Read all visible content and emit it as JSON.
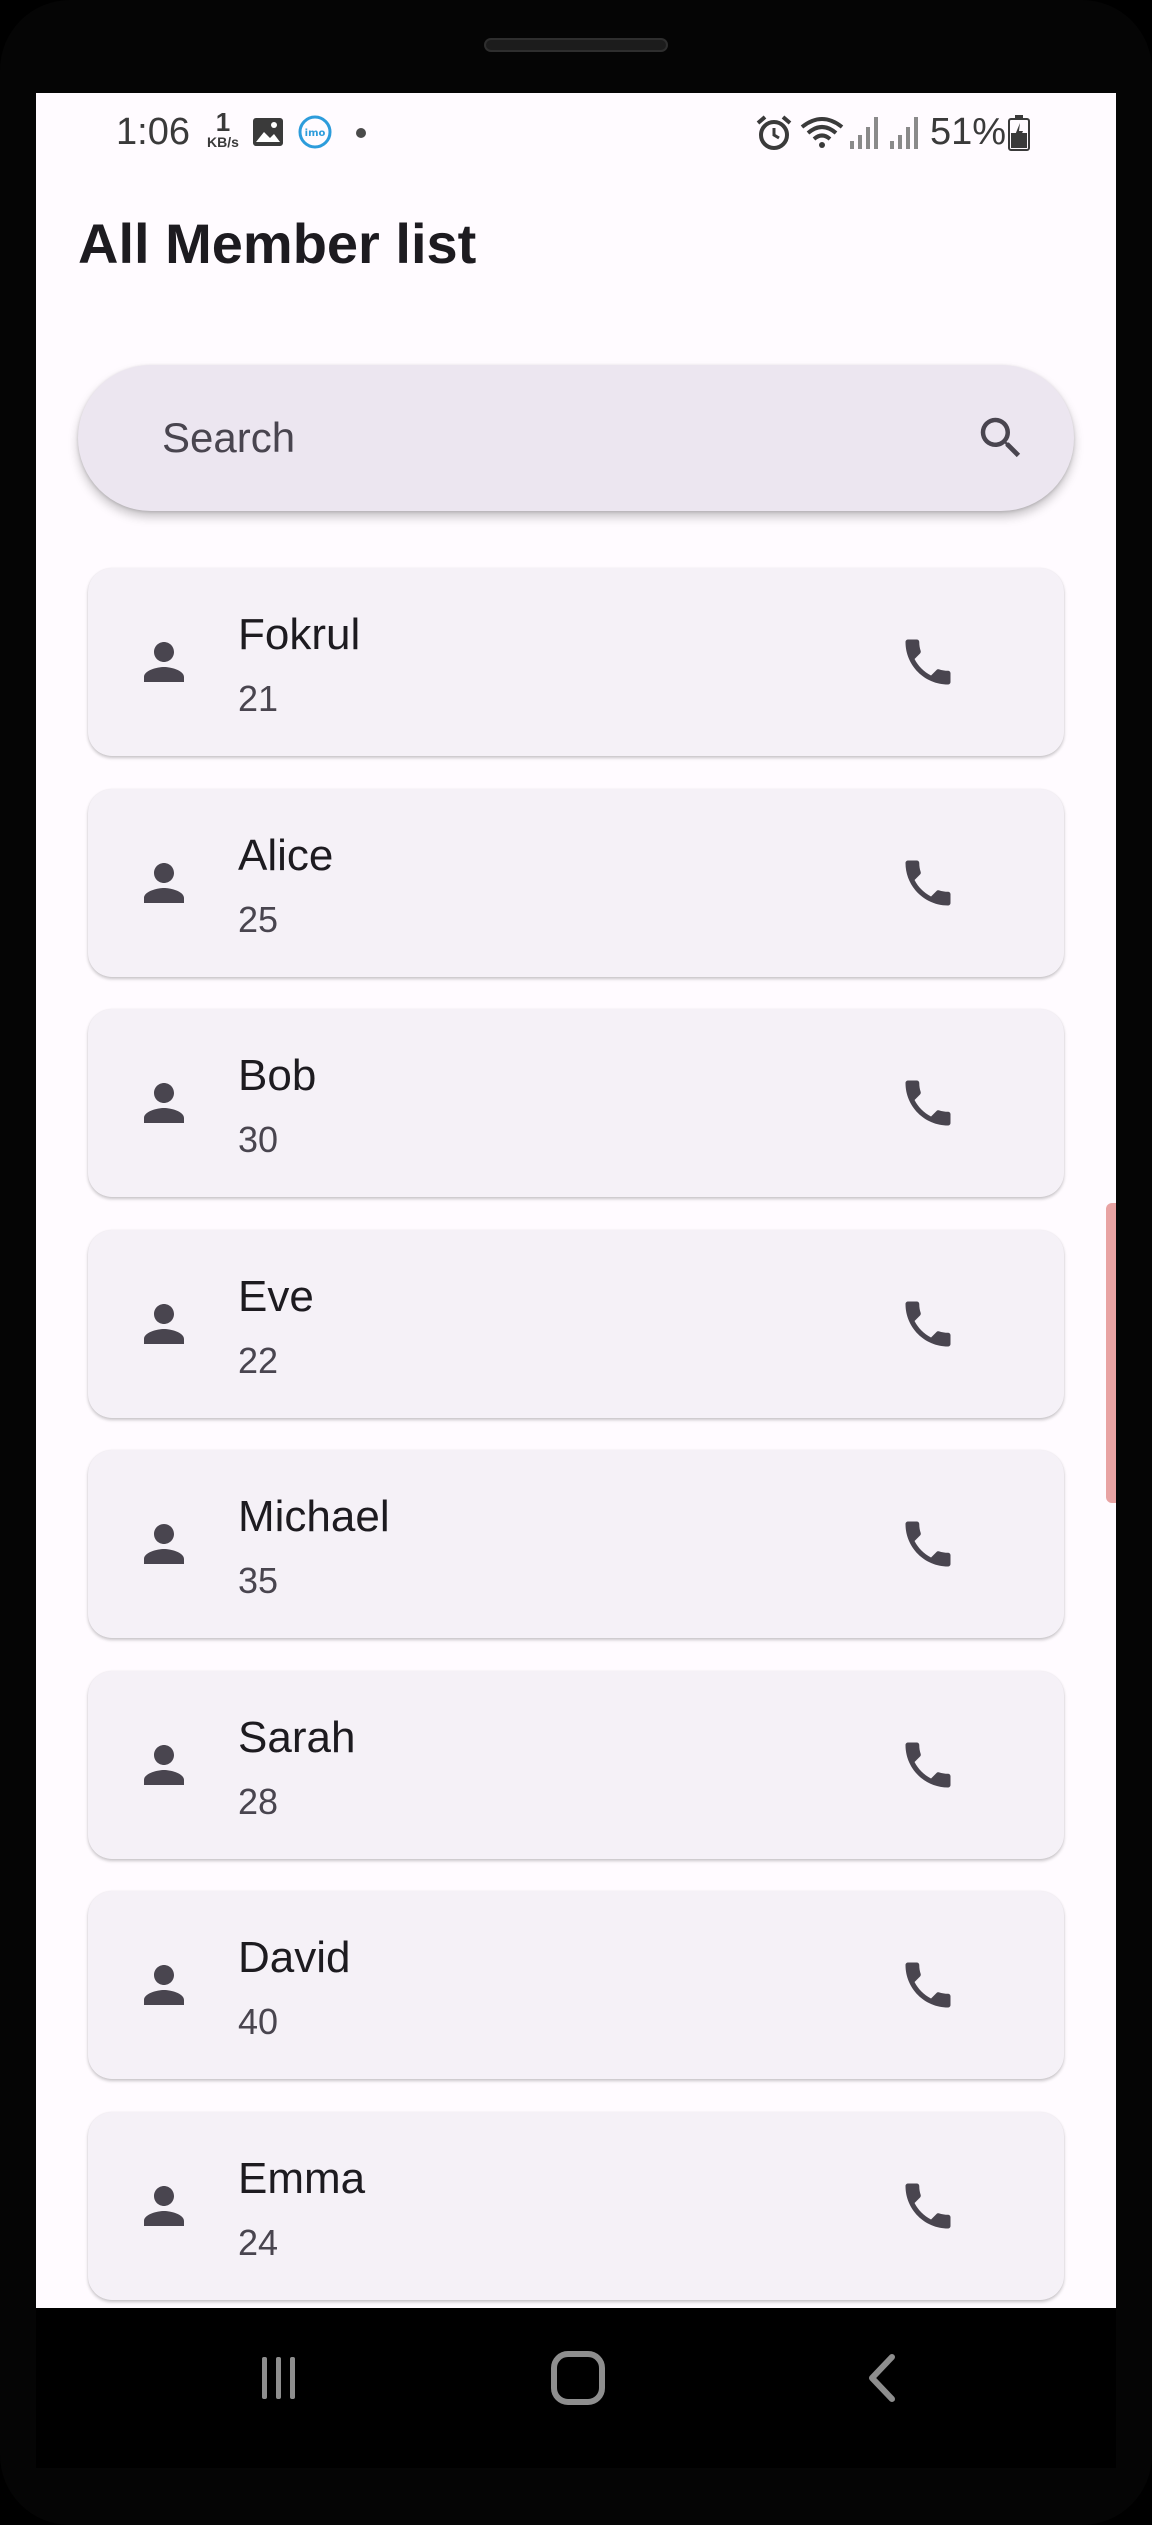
{
  "status_bar": {
    "time": "1:06",
    "net_speed_value": "1",
    "net_speed_unit": "KB/s",
    "battery_percent": "51%",
    "icons": [
      "gallery-icon",
      "imo-icon",
      "alarm-icon",
      "wifi-icon",
      "signal-icon",
      "battery-icon"
    ]
  },
  "app": {
    "title": "All Member list"
  },
  "search": {
    "placeholder": "Search",
    "value": "",
    "icon": "search-icon"
  },
  "members": [
    {
      "name": "Fokrul",
      "age": "21"
    },
    {
      "name": "Alice",
      "age": "25"
    },
    {
      "name": "Bob",
      "age": "30"
    },
    {
      "name": "Eve",
      "age": "22"
    },
    {
      "name": "Michael",
      "age": "35"
    },
    {
      "name": "Sarah",
      "age": "28"
    },
    {
      "name": "David",
      "age": "40"
    },
    {
      "name": "Emma",
      "age": "24"
    }
  ],
  "member_icons": {
    "leading": "person-icon",
    "trailing": "phone-icon"
  },
  "nav": {
    "items": [
      "recents-icon",
      "home-icon",
      "back-icon"
    ]
  },
  "colors": {
    "background": "#fffbff",
    "search_bg": "#ece6f0",
    "card_bg": "#f5f1f7",
    "icon": "#49454f",
    "text": "#1d1b20"
  }
}
